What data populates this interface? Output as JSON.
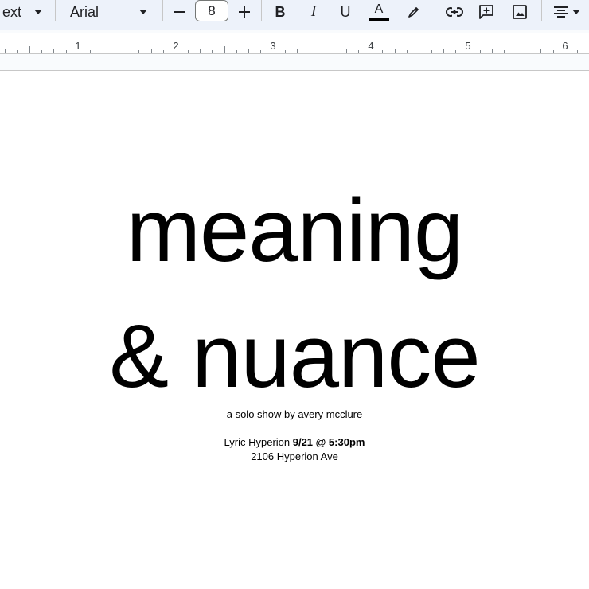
{
  "toolbar": {
    "style_label": "ext",
    "font_name": "Arial",
    "font_size": "8",
    "icons": [
      "style-dropdown-caret",
      "font-dropdown-caret",
      "decrease-size",
      "increase-size",
      "bold",
      "italic",
      "underline",
      "text-color",
      "highlight",
      "link",
      "add-comment",
      "insert-image",
      "align"
    ],
    "text_color_bar": "#000000"
  },
  "ruler": {
    "numbers": [
      "1",
      "2",
      "3",
      "4",
      "5",
      "6"
    ]
  },
  "document": {
    "title_line1": "meaning",
    "title_line2": "& nuance",
    "subtitle": "a solo show by avery mcclure",
    "venue": "Lyric Hyperion ",
    "datetime": "9/21 @ 5:30pm",
    "address": "2106 Hyperion Ave"
  }
}
